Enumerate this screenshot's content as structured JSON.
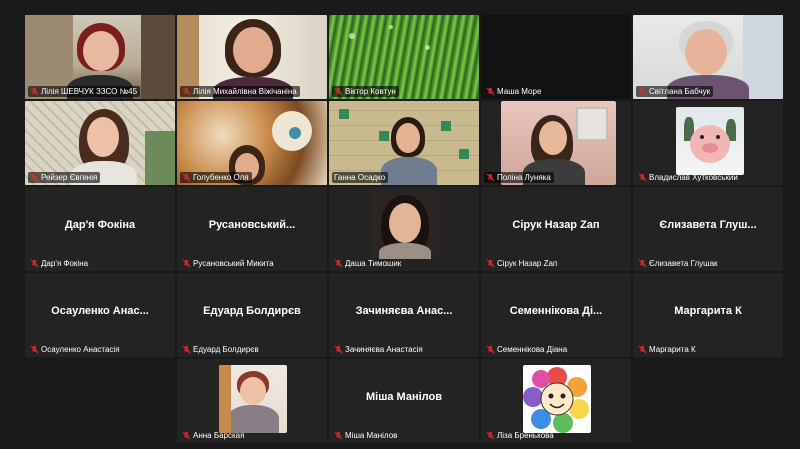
{
  "colors": {
    "background": "#1a1a1a",
    "tile": "#232323",
    "active_speaker": "#2bd06b",
    "mic_muted": "#e02828"
  },
  "participants": [
    {
      "label": "Лілія ШЕВЧУК ЗЗСО №45",
      "display": "",
      "video": true
    },
    {
      "label": "Лілія Михайлівна Віжічаніна",
      "display": "",
      "video": true
    },
    {
      "label": "Віктор Ковтун",
      "display": "",
      "video": true
    },
    {
      "label": "Маша Море",
      "display": "",
      "video": false
    },
    {
      "label": "Світлана Бабчук",
      "display": "",
      "video": true
    },
    {
      "label": "Рейзер Євгенія",
      "display": "",
      "video": true
    },
    {
      "label": "Голубенко Оля",
      "display": "",
      "video": true
    },
    {
      "label": "Ганна Осадко",
      "display": "",
      "video": true,
      "active_speaker": true
    },
    {
      "label": "Поліна Луняка",
      "display": "",
      "video": true
    },
    {
      "label": "Владислав Хутковський",
      "display": "",
      "video": true
    },
    {
      "label": "Дар'я Фокіна",
      "display": "Дар'я Фокіна",
      "video": false
    },
    {
      "label": "Русановський Микита",
      "display": "Русановський...",
      "video": false
    },
    {
      "label": "Даша Тимошик",
      "display": "",
      "video": true
    },
    {
      "label": "Сірук Назар Zап",
      "display": "Сірук Назар Zап",
      "video": false
    },
    {
      "label": "Єлизавета Глушак",
      "display": "Єлизавета Глуш...",
      "video": false
    },
    {
      "label": "Осауленко Анастасія",
      "display": "Осауленко Анас...",
      "video": false
    },
    {
      "label": "Едуард Болдирєв",
      "display": "Едуард Болдирєв",
      "video": false
    },
    {
      "label": "Зачиняєва Анастасія",
      "display": "Зачиняєва Анас...",
      "video": false
    },
    {
      "label": "Семеннікова Діана",
      "display": "Семеннікова Ді...",
      "video": false
    },
    {
      "label": "Маргарита К",
      "display": "Маргарита К",
      "video": false
    },
    {
      "label": "Анна Барская",
      "display": "",
      "video": true
    },
    {
      "label": "Міша Манілов",
      "display": "Міша Манілов",
      "video": false
    },
    {
      "label": "Ліза Бренькова",
      "display": "",
      "video": true
    }
  ]
}
